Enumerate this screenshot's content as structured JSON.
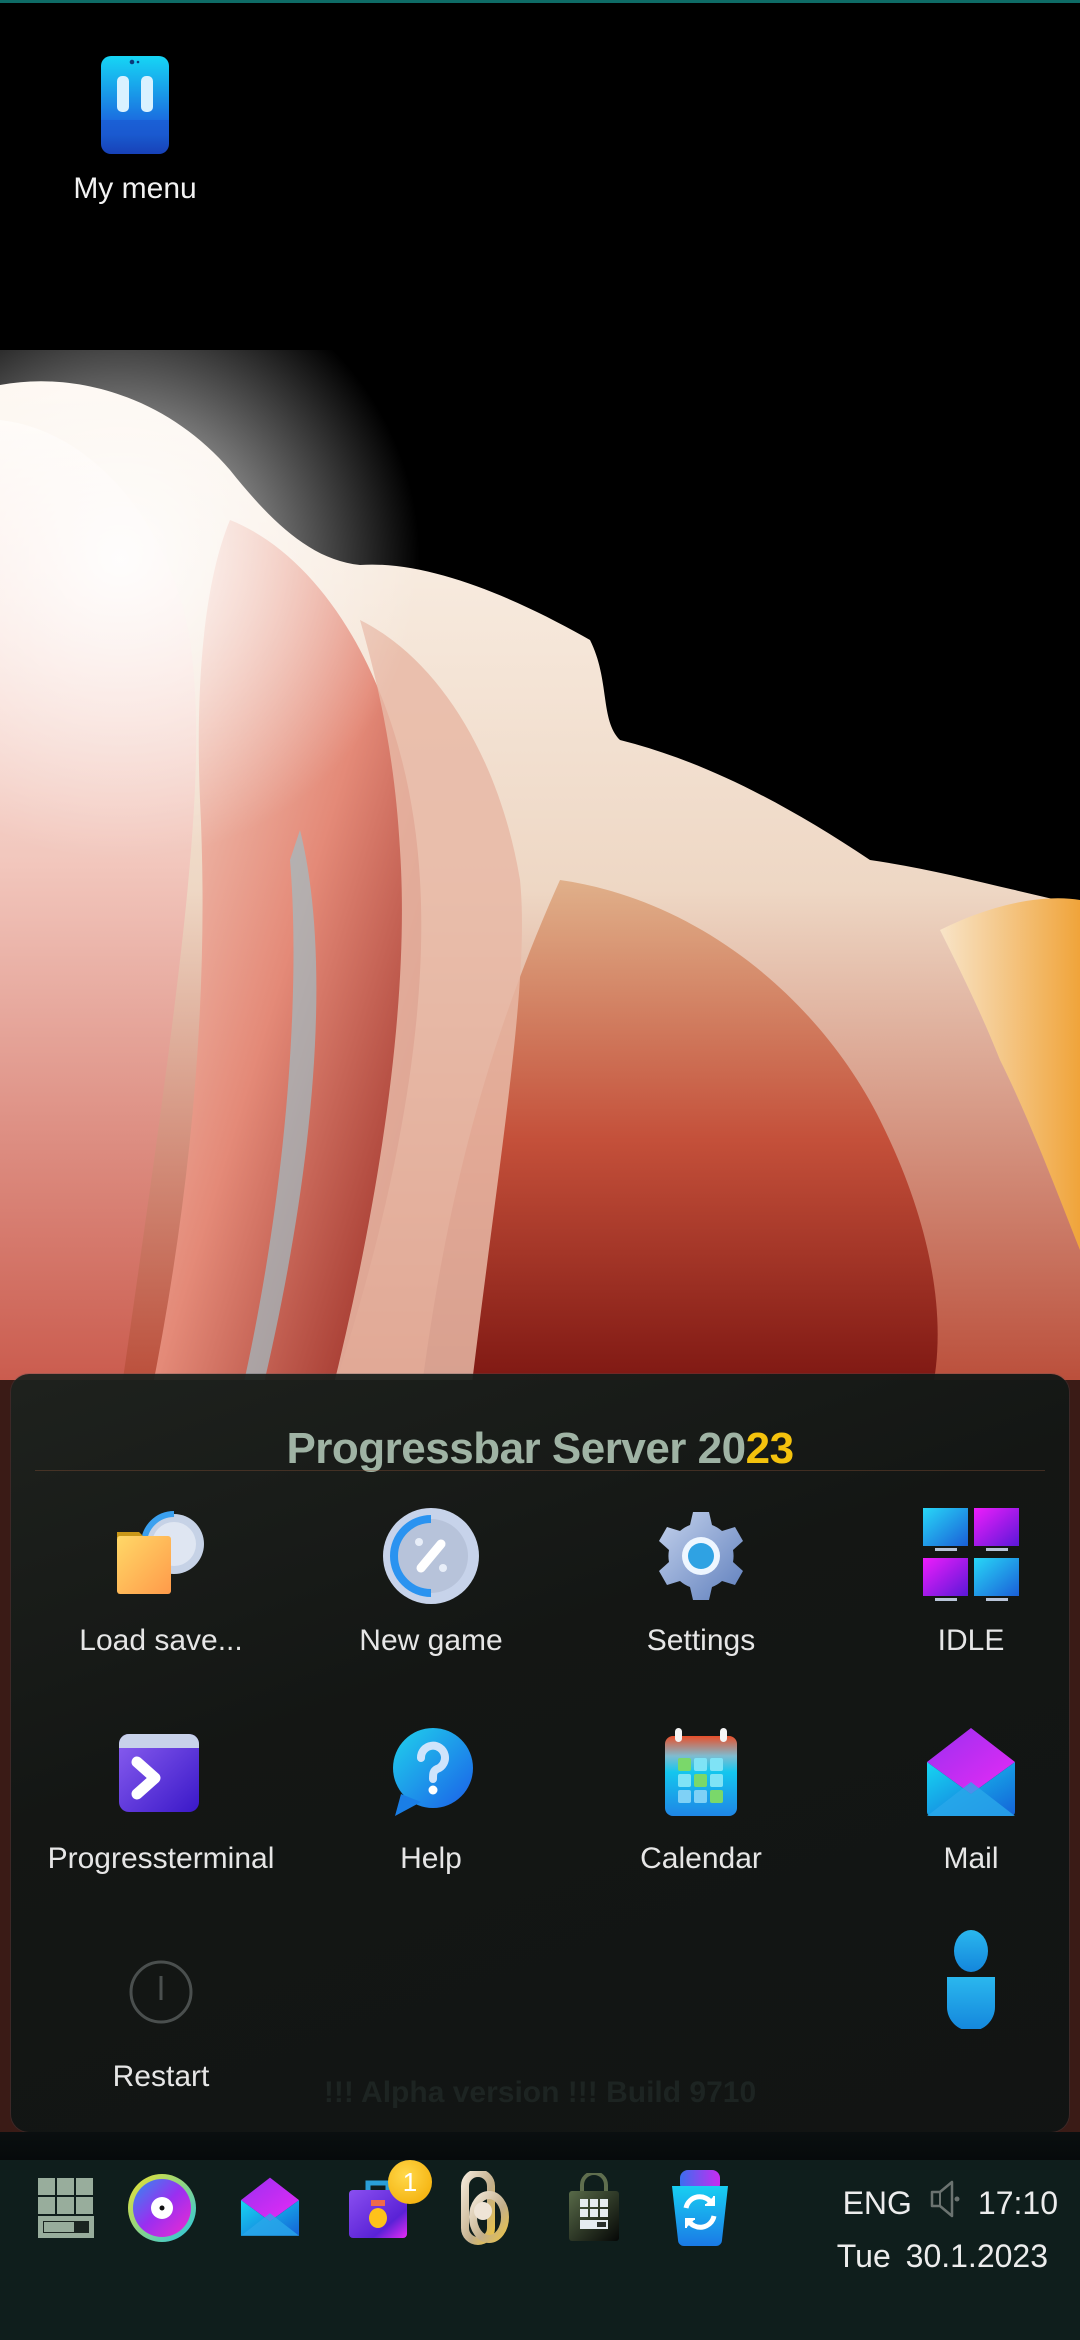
{
  "desktop": {
    "icons": [
      {
        "label": "My menu",
        "icon": "phone-11-icon"
      }
    ]
  },
  "start_panel": {
    "title_main": "Progressbar Server 20",
    "title_accent": "23",
    "tiles": [
      {
        "label": "Load save...",
        "icon": "folder-progress-icon"
      },
      {
        "label": "New game",
        "icon": "progress-disc-icon"
      },
      {
        "label": "Settings",
        "icon": "gear-icon"
      },
      {
        "label": "IDLE",
        "icon": "monitors-grid-icon"
      },
      {
        "label": "Progressterminal",
        "icon": "terminal-icon"
      },
      {
        "label": "Help",
        "icon": "help-bubble-icon"
      },
      {
        "label": "Calendar",
        "icon": "calendar-icon"
      },
      {
        "label": "Mail",
        "icon": "mail-icon"
      },
      {
        "label": "Restart",
        "icon": "power-icon"
      }
    ],
    "user_icon": "user-icon",
    "footer": "!!! Alpha version !!! Build 9710"
  },
  "taskbar": {
    "buttons": [
      {
        "name": "start",
        "icon": "start-grid-icon"
      },
      {
        "name": "progress-disc",
        "icon": "disc-icon"
      },
      {
        "name": "mail",
        "icon": "mail-icon"
      },
      {
        "name": "briefcase",
        "icon": "briefcase-icon",
        "badge": "1"
      },
      {
        "name": "link",
        "icon": "link-icon"
      },
      {
        "name": "store",
        "icon": "store-bag-icon"
      },
      {
        "name": "recycle-bin",
        "icon": "recycle-bin-icon"
      }
    ],
    "tray": {
      "language": "ENG",
      "volume_icon": "speaker-muted-icon",
      "time": "17:10",
      "day": "Tue",
      "date": "30.1.2023"
    }
  },
  "colors": {
    "accent_yellow": "#f4c20d",
    "title_gray_green": "#9fb3a4",
    "taskbar_bg": "#0f1e1c",
    "top_line": "#0e6b66"
  }
}
